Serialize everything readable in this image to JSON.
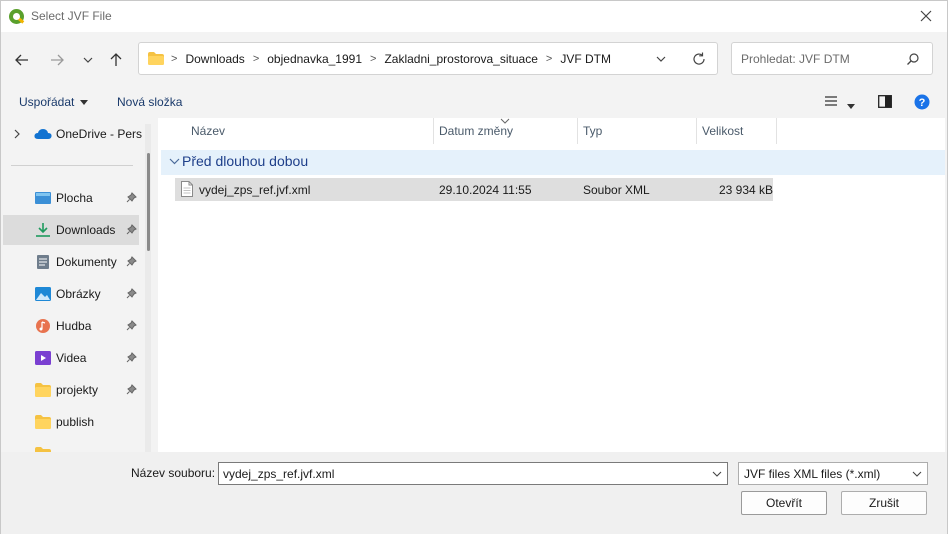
{
  "window": {
    "title": "Select JVF File"
  },
  "nav": {
    "breadcrumbs": [
      "Downloads",
      "objednavka_1991",
      "Zakladni_prostorova_situace",
      "JVF DTM"
    ],
    "search_placeholder": "Prohledat: JVF DTM"
  },
  "toolbar": {
    "organize_label": "Uspořádat",
    "new_folder_label": "Nová složka"
  },
  "navpane": {
    "onedrive_label": "OneDrive - Pers",
    "items": [
      {
        "label": "Plocha",
        "icon": "desktop-icon",
        "pinned": true
      },
      {
        "label": "Downloads",
        "icon": "download-icon",
        "pinned": true,
        "selected": true
      },
      {
        "label": "Dokumenty",
        "icon": "document-icon",
        "pinned": true
      },
      {
        "label": "Obrázky",
        "icon": "picture-icon",
        "pinned": true
      },
      {
        "label": "Hudba",
        "icon": "music-icon",
        "pinned": true
      },
      {
        "label": "Videa",
        "icon": "video-icon",
        "pinned": true
      },
      {
        "label": "projekty",
        "icon": "folder-icon",
        "pinned": true
      },
      {
        "label": "publish",
        "icon": "folder-icon",
        "pinned": false
      }
    ]
  },
  "filelist": {
    "columns": [
      "Název",
      "Datum změny",
      "Typ",
      "Velikost"
    ],
    "group_label": "Před dlouhou dobou",
    "files": [
      {
        "name": "vydej_zps_ref.jvf.xml",
        "date": "29.10.2024 11:55",
        "type": "Soubor XML",
        "size": "23 934 kB"
      }
    ]
  },
  "bottom": {
    "filename_label": "Název souboru:",
    "filename_value": "vydej_zps_ref.jvf.xml",
    "filetype_value": "JVF files XML files (*.xml)",
    "open_label": "Otevřít",
    "cancel_label": "Zrušit"
  },
  "colors": {
    "accent": "#1e3f8a",
    "group_bg": "#e5f1fb",
    "selected_row": "#dedede",
    "help": "#1a73e8"
  }
}
